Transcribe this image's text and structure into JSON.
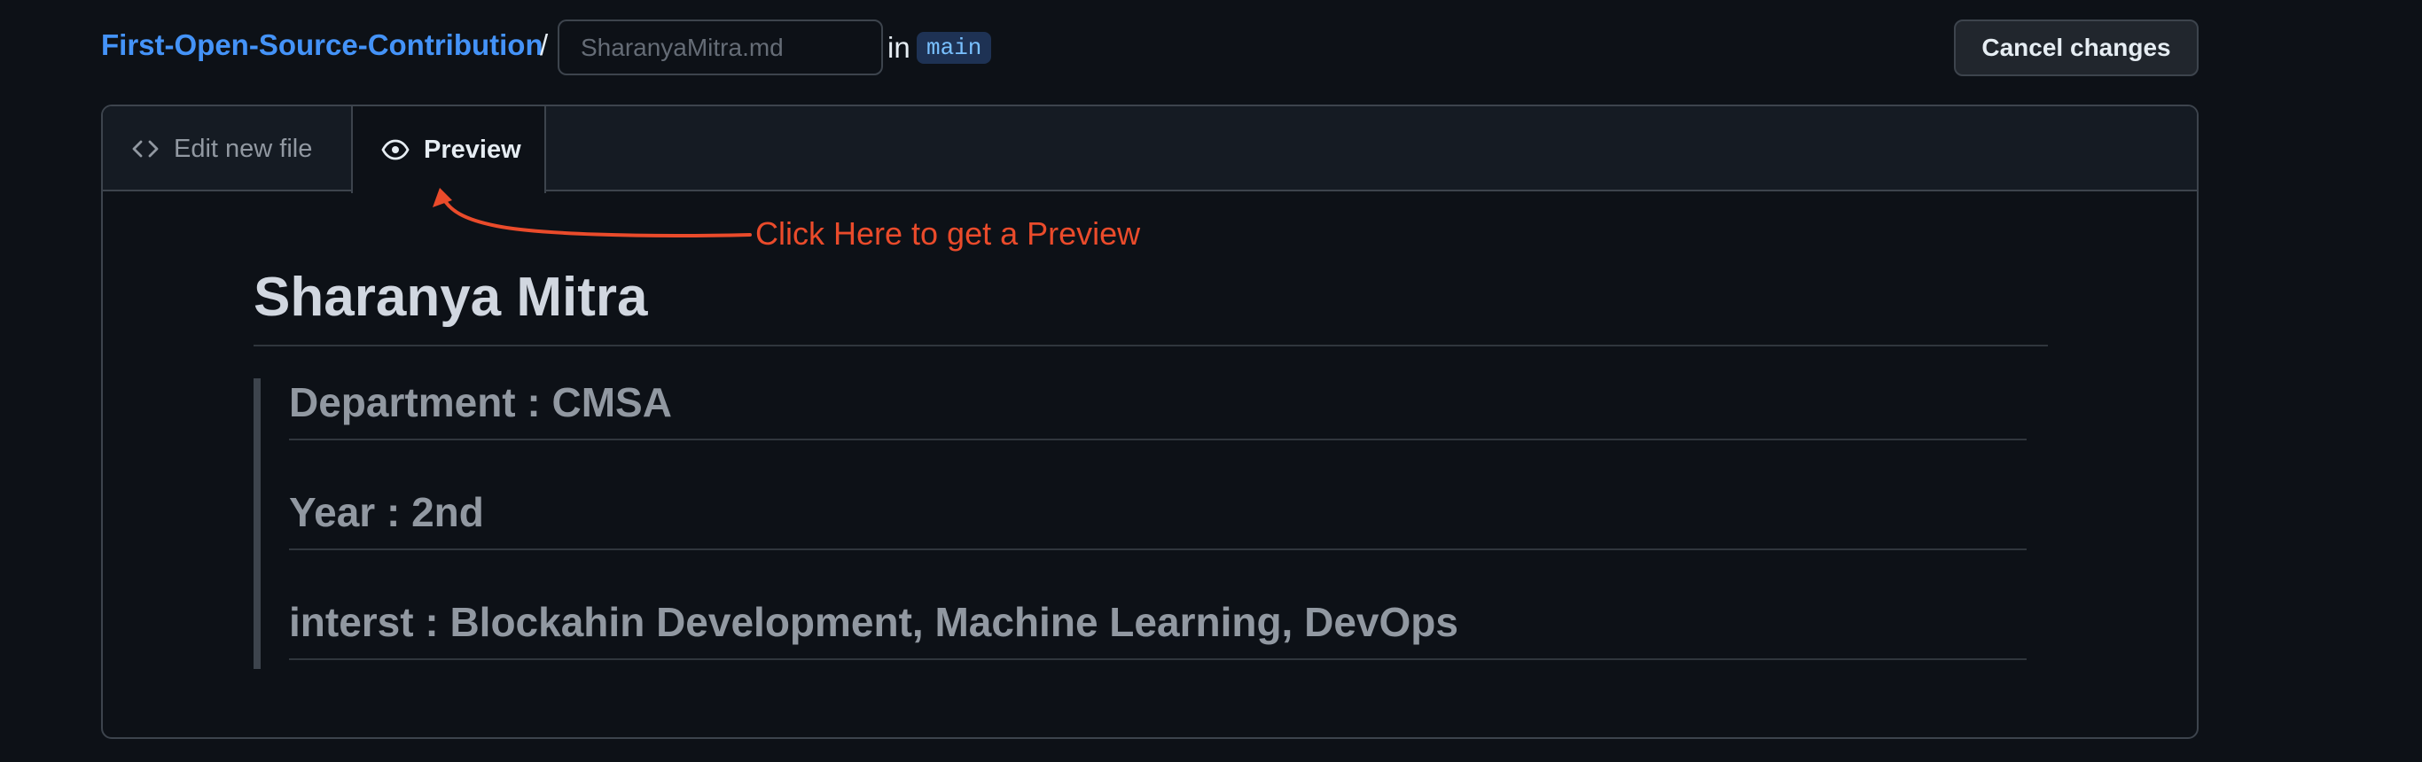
{
  "header": {
    "repo_name": "First-Open-Source-Contribution",
    "separator": "/",
    "filename_placeholder": "SharanyaMitra.md",
    "in_label": "in",
    "branch": "main",
    "cancel_label": "Cancel changes"
  },
  "tabs": {
    "edit_label": "Edit new file",
    "edit_icon": "code-icon",
    "preview_label": "Preview",
    "preview_icon": "eye-icon",
    "active": "Preview"
  },
  "preview": {
    "title": "Sharanya Mitra",
    "quote_lines": [
      "Department : CMSA",
      "Year : 2nd",
      "interst : Blockahin Development, Machine Learning, DevOps"
    ]
  },
  "annotation": {
    "text": "Click Here to get a Preview",
    "color": "#ea4b2b"
  },
  "colors": {
    "background": "#0d1117",
    "link": "#4493f8",
    "border": "#3d444d"
  }
}
